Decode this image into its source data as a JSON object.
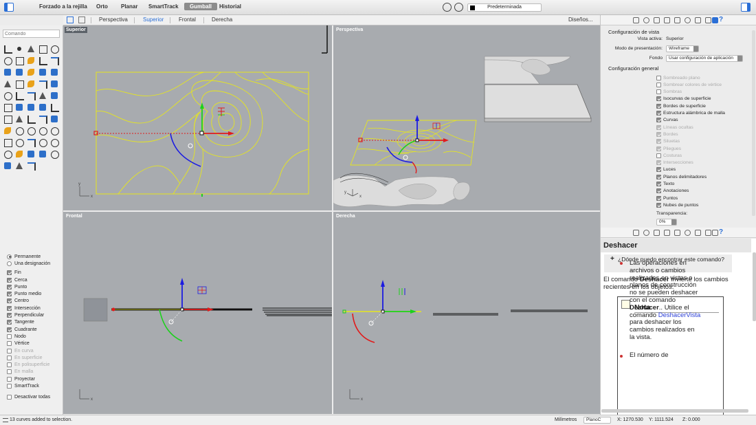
{
  "toolbar": {
    "modes": [
      "Forzado a la rejilla",
      "Orto",
      "Planar",
      "SmartTrack",
      "Gumball",
      "Historial"
    ],
    "active_mode": "Gumball",
    "layer": "Predeterminada"
  },
  "tabs": {
    "items": [
      "Perspectiva",
      "Superior",
      "Frontal",
      "Derecha"
    ],
    "active": "Superior",
    "designs": "Diseños..."
  },
  "command": {
    "placeholder": "Comando"
  },
  "osnap": {
    "items": [
      {
        "label": "Permanente",
        "kind": "radio",
        "state": "on"
      },
      {
        "label": "Una designación",
        "kind": "radio",
        "state": "off"
      },
      {
        "label": "Fin",
        "kind": "check",
        "state": "on"
      },
      {
        "label": "Cerca",
        "kind": "check",
        "state": "on"
      },
      {
        "label": "Punto",
        "kind": "check",
        "state": "on"
      },
      {
        "label": "Punto medio",
        "kind": "check",
        "state": "on"
      },
      {
        "label": "Centro",
        "kind": "check",
        "state": "on"
      },
      {
        "label": "Intersección",
        "kind": "check",
        "state": "on"
      },
      {
        "label": "Perpendicular",
        "kind": "check",
        "state": "on"
      },
      {
        "label": "Tangente",
        "kind": "check",
        "state": "on"
      },
      {
        "label": "Cuadrante",
        "kind": "check",
        "state": "on"
      },
      {
        "label": "Nodo",
        "kind": "check",
        "state": "off"
      },
      {
        "label": "Vértice",
        "kind": "check",
        "state": "off"
      },
      {
        "label": "En curva",
        "kind": "check",
        "state": "disabled"
      },
      {
        "label": "En superficie",
        "kind": "check",
        "state": "disabled"
      },
      {
        "label": "En polisuperficie",
        "kind": "check",
        "state": "disabled"
      },
      {
        "label": "En malla",
        "kind": "check",
        "state": "disabled"
      },
      {
        "label": "Proyectar",
        "kind": "check",
        "state": "off"
      },
      {
        "label": "SmartTrack",
        "kind": "check",
        "state": "off"
      }
    ],
    "disable_all": "Desactivar todas"
  },
  "viewports": {
    "top": "Superior",
    "perspective": "Perspectiva",
    "front": "Frontal",
    "right": "Derecha",
    "axis_x": "x",
    "axis_y": "y"
  },
  "properties": {
    "section_view": "Configuración de vista",
    "active_view_label": "Vista activa:",
    "active_view_value": "Superior",
    "display_mode_label": "Modo de presentación:",
    "display_mode_value": "Wireframe",
    "background_label": "Fondo",
    "background_value": "Usar configuración de aplicación",
    "section_general": "Configuración general",
    "options": [
      {
        "label": "Sombreado plano",
        "state": "disabled"
      },
      {
        "label": "Sombrear colores de vértice",
        "state": "disabled"
      },
      {
        "label": "Sombras",
        "state": "disabled"
      },
      {
        "label": "Isocurvas de superficie",
        "state": "on"
      },
      {
        "label": "Bordes de superficie",
        "state": "on"
      },
      {
        "label": "Estructura alámbrica de malla",
        "state": "on"
      },
      {
        "label": "Curvas",
        "state": "on"
      },
      {
        "label": "Líneas ocultas",
        "state": "disabled-on"
      },
      {
        "label": "Bordes",
        "state": "disabled-on"
      },
      {
        "label": "Siluetas",
        "state": "disabled-on"
      },
      {
        "label": "Pliegues",
        "state": "disabled-on"
      },
      {
        "label": "Costuras",
        "state": "disabled"
      },
      {
        "label": "Intersecciones",
        "state": "disabled-on"
      },
      {
        "label": "Luces",
        "state": "on"
      },
      {
        "label": "Planos delimitadores",
        "state": "on"
      },
      {
        "label": "Texto",
        "state": "on"
      },
      {
        "label": "Anotaciones",
        "state": "on"
      },
      {
        "label": "Puntos",
        "state": "on"
      },
      {
        "label": "Nubes de puntos",
        "state": "on"
      }
    ],
    "transparency_label": "Transparencia:",
    "transparency_value": "0%"
  },
  "help": {
    "title": "Deshacer",
    "faq": "¿Dónde puedo encontrar este comando?",
    "intro_prefix": "El comando ",
    "intro_bold": "Deshacer",
    "intro_suffix": " invierte los cambios recientes en los objetos.",
    "note_title": "Nota",
    "note_text_1": "Las operaciones en archivos o cambios realizados en vistas o planos de construcción no se pueden deshacer con el comando ",
    "note_bold": "Deshacer",
    "note_text_2": ".. Utilice el comando ",
    "note_link": "DeshacerVista",
    "note_text_3": " para deshacer los cambios realizados en la vista.",
    "note_text_4": "El número de"
  },
  "status": {
    "message": "13 curves added to selection.",
    "units": "Milímetros",
    "plane": "PlanoC",
    "x": "X: 1270.530",
    "y": "Y: 1111.524",
    "z": "Z: 0.000"
  },
  "colors": {
    "accent": "#2b6fd6",
    "viewport_bg": "#a8abaf",
    "curve_yellow": "#e6e61e",
    "gumball_red": "#e11b1b",
    "gumball_green": "#1bd11b",
    "gumball_blue": "#1b1be1"
  }
}
